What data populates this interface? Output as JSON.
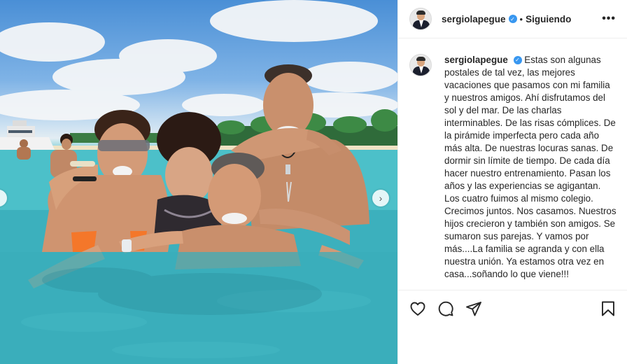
{
  "post": {
    "username": "sergiolapegue",
    "follow_state": "Siguiendo",
    "separator": "•",
    "caption": "Estas son algunas postales de tal vez, las mejores vacaciones que pasamos con mi familia y nuestros amigos. Ahí disfrutamos del sol y del mar. De las charlas interminables. De las risas cómplices. De la pirámide imperfecta pero cada año más alta. De nuestras locuras sanas. De dormir sin límite de tiempo. De cada día hacer nuestro entrenamiento. Pasan los años y las experiencias se agigantan. Los cuatro fuimos al mismo colegio. Crecimos juntos. Nos casamos. Nuestros hijos crecieron y también son amigos. Se sumaron sus parejas. Y vamos por más....La familia se agranda y con ella nuestra unión. Ya estamos otra vez en casa...soñando lo que viene!!!"
  },
  "photo": {
    "description_icon": "beach-photo",
    "next_arrow": "›",
    "prev_arrow": "‹"
  },
  "icons": {
    "verified": "verified-badge-icon",
    "more": "more-options-icon",
    "like": "heart-icon",
    "comment": "comment-icon",
    "share": "share-icon",
    "save": "bookmark-icon"
  },
  "colors": {
    "verified": "#3897f0",
    "text": "#262626",
    "border": "#efefef"
  }
}
